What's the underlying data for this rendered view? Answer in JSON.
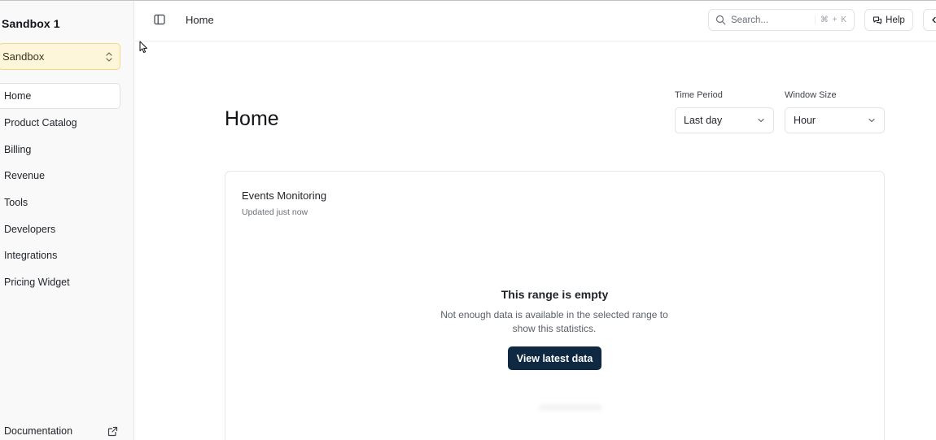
{
  "org": {
    "title": "Sandbox 1"
  },
  "environment": {
    "selected": "Sandbox"
  },
  "sidebar": {
    "items": [
      {
        "label": "Home"
      },
      {
        "label": "Product Catalog"
      },
      {
        "label": "Billing"
      },
      {
        "label": "Revenue"
      },
      {
        "label": "Tools"
      },
      {
        "label": "Developers"
      },
      {
        "label": "Integrations"
      },
      {
        "label": "Pricing Widget"
      }
    ],
    "footer": {
      "label": "Documentation"
    }
  },
  "header": {
    "breadcrumb": "Home",
    "search_placeholder": "Search...",
    "search_shortcut": "⌘ + K",
    "help_label": "Help"
  },
  "main": {
    "title": "Home",
    "time_period": {
      "label": "Time Period",
      "value": "Last day"
    },
    "window_size": {
      "label": "Window Size",
      "value": "Hour"
    },
    "card": {
      "title": "Events Monitoring",
      "subtitle": "Updated just now",
      "empty_title": "This range is empty",
      "empty_description": "Not enough data is available in the selected range to show this statistics.",
      "cta_label": "View latest data"
    }
  },
  "colors": {
    "accent_button": "#0f2942",
    "environment_badge_bg": "#fdf6db",
    "environment_badge_border": "#efd985"
  }
}
